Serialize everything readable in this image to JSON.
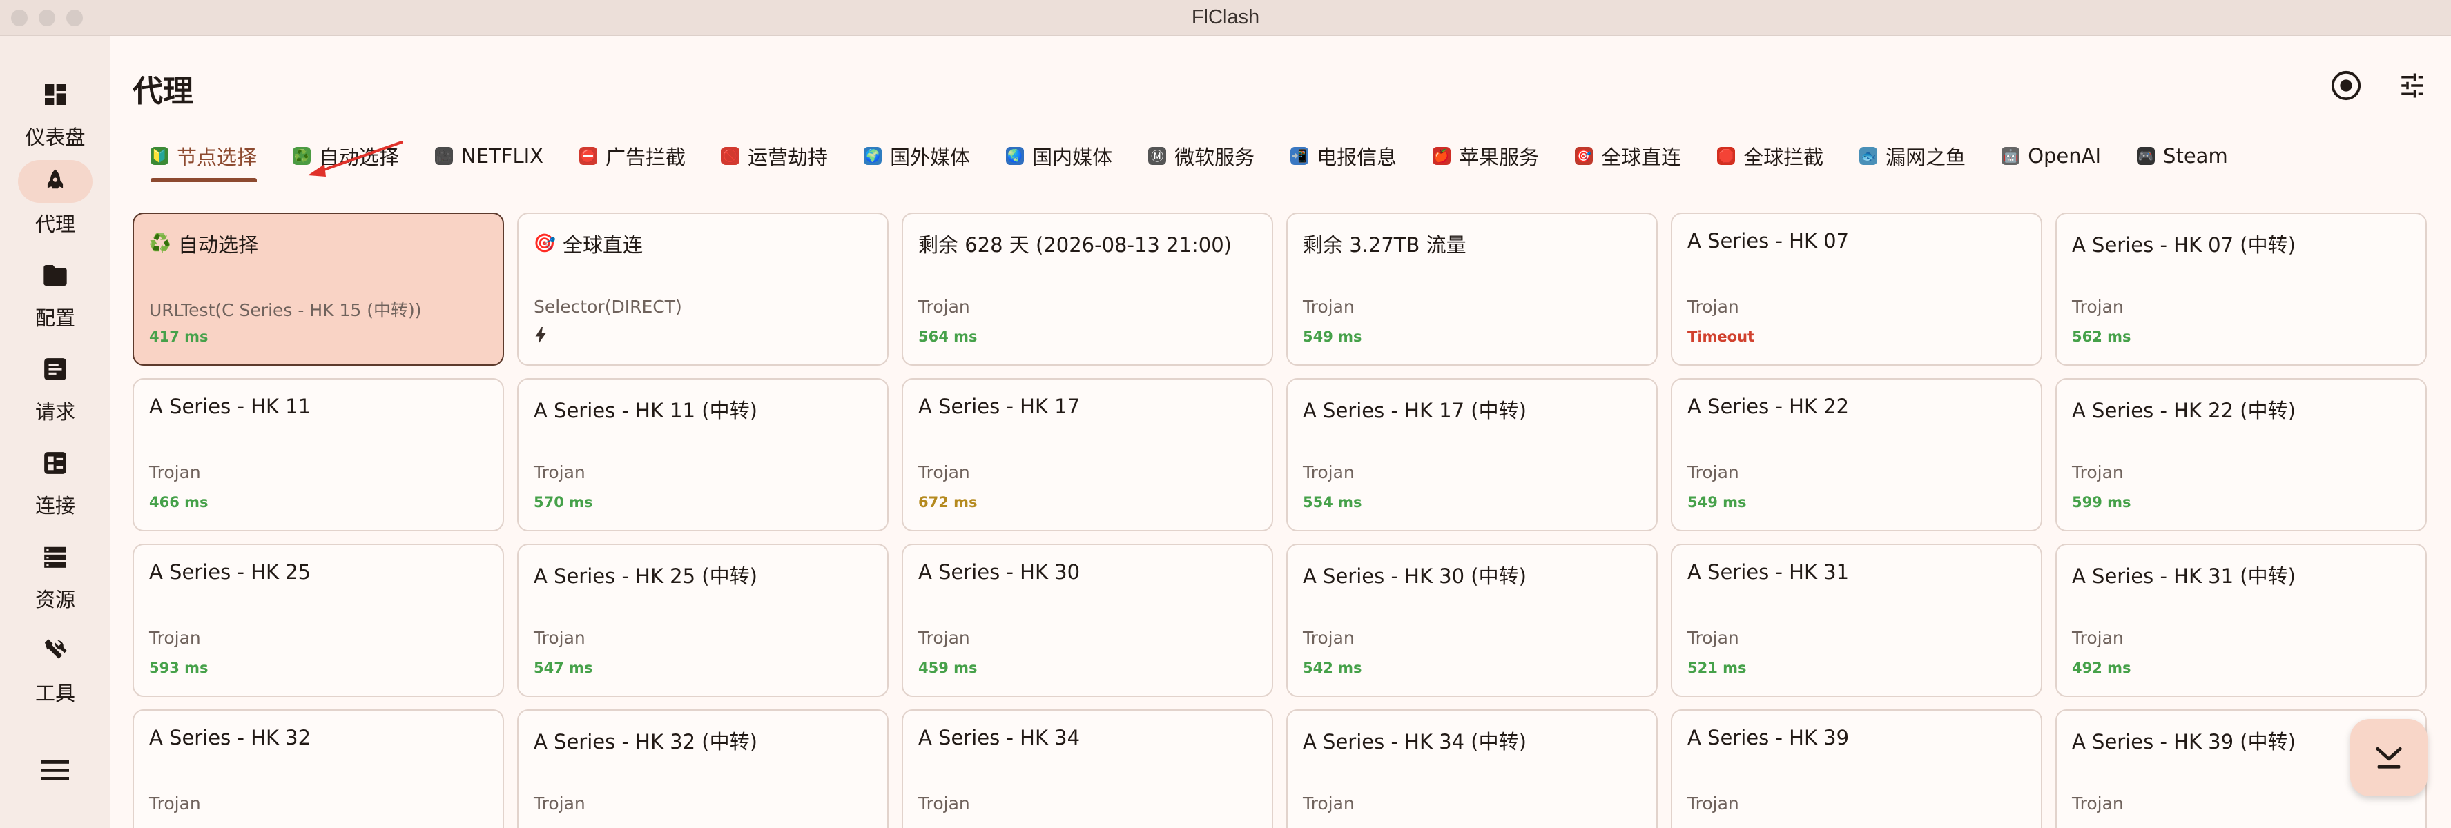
{
  "window": {
    "title": "FlClash"
  },
  "sidebar": {
    "items": [
      {
        "label": "仪表盘",
        "icon": "dashboard-icon",
        "active": false
      },
      {
        "label": "代理",
        "icon": "rocket-icon",
        "active": true
      },
      {
        "label": "配置",
        "icon": "folder-icon",
        "active": false
      },
      {
        "label": "请求",
        "icon": "request-icon",
        "active": false
      },
      {
        "label": "连接",
        "icon": "connections-icon",
        "active": false
      },
      {
        "label": "资源",
        "icon": "storage-icon",
        "active": false
      },
      {
        "label": "工具",
        "icon": "tools-icon",
        "active": false
      }
    ],
    "menu_icon": "menu-icon"
  },
  "header": {
    "title": "代理",
    "actions": [
      "target-icon",
      "tune-icon"
    ]
  },
  "tabs": [
    {
      "label": "节点选择",
      "icon": "🔰",
      "active": true
    },
    {
      "label": "自动选择",
      "icon": "♻️",
      "active": false
    },
    {
      "label": "NETFLIX",
      "icon": "🎥",
      "active": false
    },
    {
      "label": "广告拦截",
      "icon": "⛔",
      "active": false
    },
    {
      "label": "运营劫持",
      "icon": "🚫",
      "active": false
    },
    {
      "label": "国外媒体",
      "icon": "🌍",
      "active": false
    },
    {
      "label": "国内媒体",
      "icon": "🌏",
      "active": false
    },
    {
      "label": "微软服务",
      "icon": "Ⓜ",
      "active": false
    },
    {
      "label": "电报信息",
      "icon": "📲",
      "active": false
    },
    {
      "label": "苹果服务",
      "icon": "🍎",
      "active": false
    },
    {
      "label": "全球直连",
      "icon": "🎯",
      "active": false
    },
    {
      "label": "全球拦截",
      "icon": "🛑",
      "active": false
    },
    {
      "label": "漏网之鱼",
      "icon": "🐟",
      "active": false
    },
    {
      "label": "OpenAI",
      "icon": "🤖",
      "active": false
    },
    {
      "label": "Steam",
      "icon": "🎮",
      "active": false
    }
  ],
  "proxies": [
    {
      "name": "自动选择",
      "icon": "♻️",
      "type": "URLTest(C Series - HK 15 (中转))",
      "delay": "417 ms",
      "status": "ok",
      "selected": true
    },
    {
      "name": "全球直连",
      "icon": "🎯",
      "type": "Selector(DIRECT)",
      "delay": "",
      "status": "bolt",
      "selected": false
    },
    {
      "name": "剩余 628 天 (2026-08-13 21:00)",
      "type": "Trojan",
      "delay": "564 ms",
      "status": "ok"
    },
    {
      "name": "剩余 3.27TB 流量",
      "type": "Trojan",
      "delay": "549 ms",
      "status": "ok"
    },
    {
      "name": "A Series - HK 07",
      "type": "Trojan",
      "delay": "Timeout",
      "status": "bad"
    },
    {
      "name": "A Series - HK 07 (中转)",
      "type": "Trojan",
      "delay": "562 ms",
      "status": "ok"
    },
    {
      "name": "A Series - HK 11",
      "type": "Trojan",
      "delay": "466 ms",
      "status": "ok"
    },
    {
      "name": "A Series - HK 11 (中转)",
      "type": "Trojan",
      "delay": "570 ms",
      "status": "ok"
    },
    {
      "name": "A Series - HK 17",
      "type": "Trojan",
      "delay": "672 ms",
      "status": "mid"
    },
    {
      "name": "A Series - HK 17 (中转)",
      "type": "Trojan",
      "delay": "554 ms",
      "status": "ok"
    },
    {
      "name": "A Series - HK 22",
      "type": "Trojan",
      "delay": "549 ms",
      "status": "ok"
    },
    {
      "name": "A Series - HK 22 (中转)",
      "type": "Trojan",
      "delay": "599 ms",
      "status": "ok"
    },
    {
      "name": "A Series - HK 25",
      "type": "Trojan",
      "delay": "593 ms",
      "status": "ok"
    },
    {
      "name": "A Series - HK 25 (中转)",
      "type": "Trojan",
      "delay": "547 ms",
      "status": "ok"
    },
    {
      "name": "A Series - HK 30",
      "type": "Trojan",
      "delay": "459 ms",
      "status": "ok"
    },
    {
      "name": "A Series - HK 30 (中转)",
      "type": "Trojan",
      "delay": "542 ms",
      "status": "ok"
    },
    {
      "name": "A Series - HK 31",
      "type": "Trojan",
      "delay": "521 ms",
      "status": "ok"
    },
    {
      "name": "A Series - HK 31 (中转)",
      "type": "Trojan",
      "delay": "492 ms",
      "status": "ok"
    },
    {
      "name": "A Series - HK 32",
      "type": "Trojan",
      "delay": "",
      "status": ""
    },
    {
      "name": "A Series - HK 32 (中转)",
      "type": "Trojan",
      "delay": "",
      "status": ""
    },
    {
      "name": "A Series - HK 34",
      "type": "Trojan",
      "delay": "",
      "status": ""
    },
    {
      "name": "A Series - HK 34 (中转)",
      "type": "Trojan",
      "delay": "",
      "status": ""
    },
    {
      "name": "A Series - HK 39",
      "type": "Trojan",
      "delay": "",
      "status": ""
    },
    {
      "name": "A Series - HK 39 (中转)",
      "type": "Trojan",
      "delay": "",
      "status": ""
    }
  ],
  "fab": {
    "icon": "collapse-down-icon"
  },
  "colors": {
    "accent": "#8d4a2f",
    "delay_ok": "#46a14a",
    "delay_mid": "#b58a1f",
    "delay_bad": "#d1412e",
    "annotation": "#e0322a"
  }
}
